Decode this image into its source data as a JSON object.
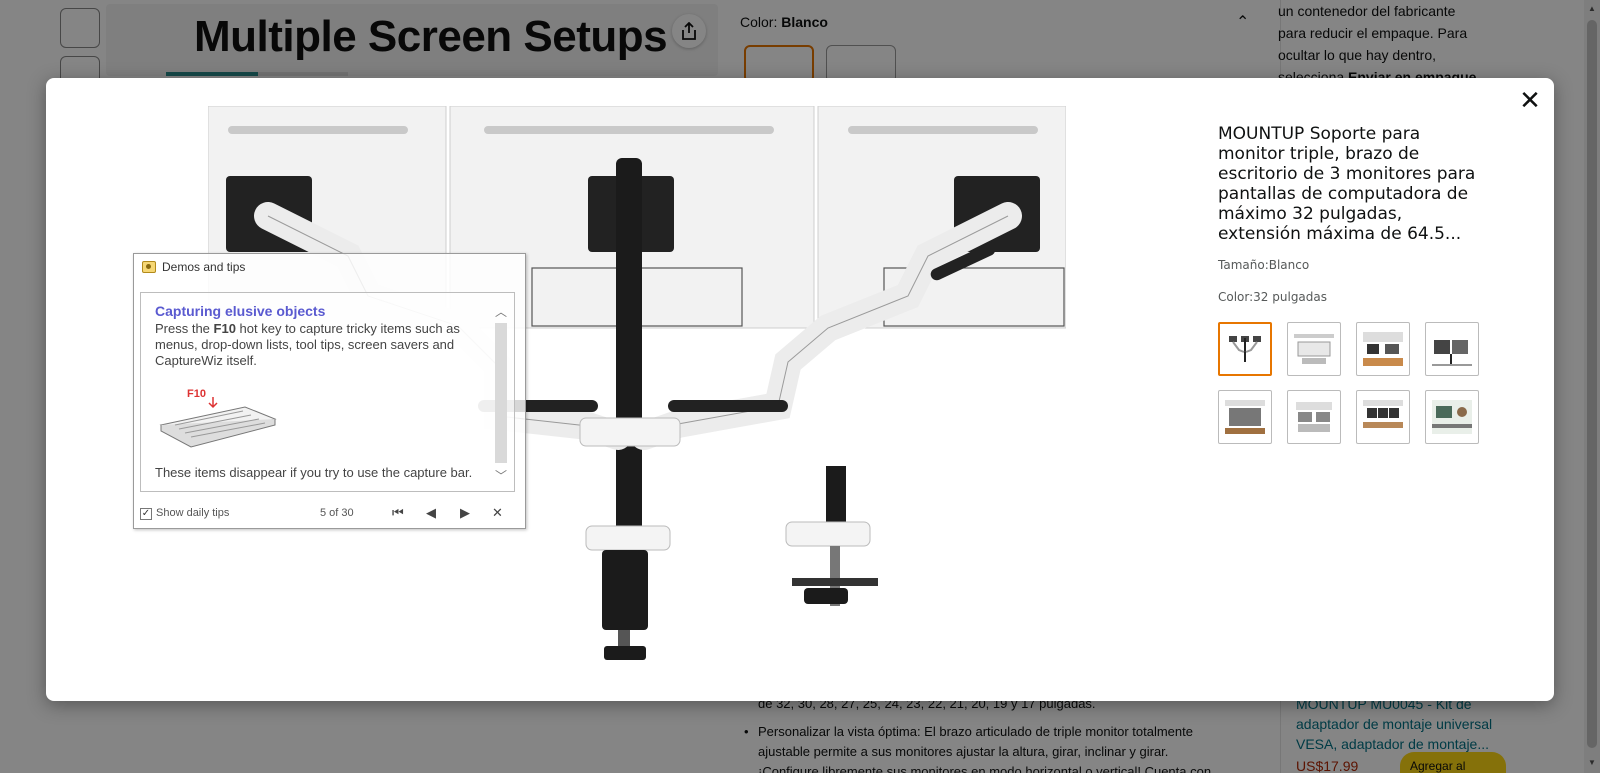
{
  "background": {
    "hero_title": "Multiple Screen Setups",
    "color_label": "Color:",
    "color_value": "Blanco",
    "right_col_lines": [
      "un contenedor del fabricante",
      "para reducir el empaque. Para",
      "ocultar lo que hay dentro,",
      "selecciona "
    ],
    "right_col_bold": "Enviar en empaque",
    "bullet_1": "de 32, 30, 28, 27, 25, 24, 23, 22, 21, 20, 19 y 17 pulgadas.",
    "bullet_2": "Personalizar la vista óptima: El brazo articulado de triple monitor totalmente ajustable permite a sus monitores ajustar la altura, girar, inclinar y girar. ¡Configure libremente sus monitores en modo horizontal o vertical! Cuenta con múltiples",
    "rec_title": "MOUNTUP MU0045 - Kit de adaptador de montaje universal VESA, adaptador de montaje...",
    "rec_price": "US$17.99",
    "rec_cart": "Agregar al Carrito"
  },
  "modal": {
    "close_label": "✕",
    "title": "MOUNTUP Soporte para monitor triple, brazo de escritorio de 3 monitores para pantallas de computadora de máximo 32 pulgadas, extensión máxima de 64.5...",
    "size_label": "Tamaño:",
    "size_value": "Blanco",
    "color_label": "Color:",
    "color_value": "32 pulgadas",
    "thumbnails": [
      "arm-diagram",
      "size-chart",
      "usage-scene",
      "desk-scene",
      "install-1",
      "install-2",
      "office-scene",
      "workspace-scene"
    ],
    "accent": "#e77600"
  },
  "tips_window": {
    "title": "Demos and tips",
    "heading": "Capturing elusive objects",
    "text_before": "Press the ",
    "text_key": "F10",
    "text_after": " hot key to capture tricky items such as menus, drop-down lists, tool tips, screen savers and CaptureWiz itself.",
    "key_label": "F10",
    "footer": "These items disappear if you try to use the capture bar.",
    "show_daily": "Show daily tips",
    "counter": "5 of 30",
    "nav_first": "⏮",
    "nav_prev": "◀",
    "nav_next": "▶",
    "nav_close": "✕"
  }
}
